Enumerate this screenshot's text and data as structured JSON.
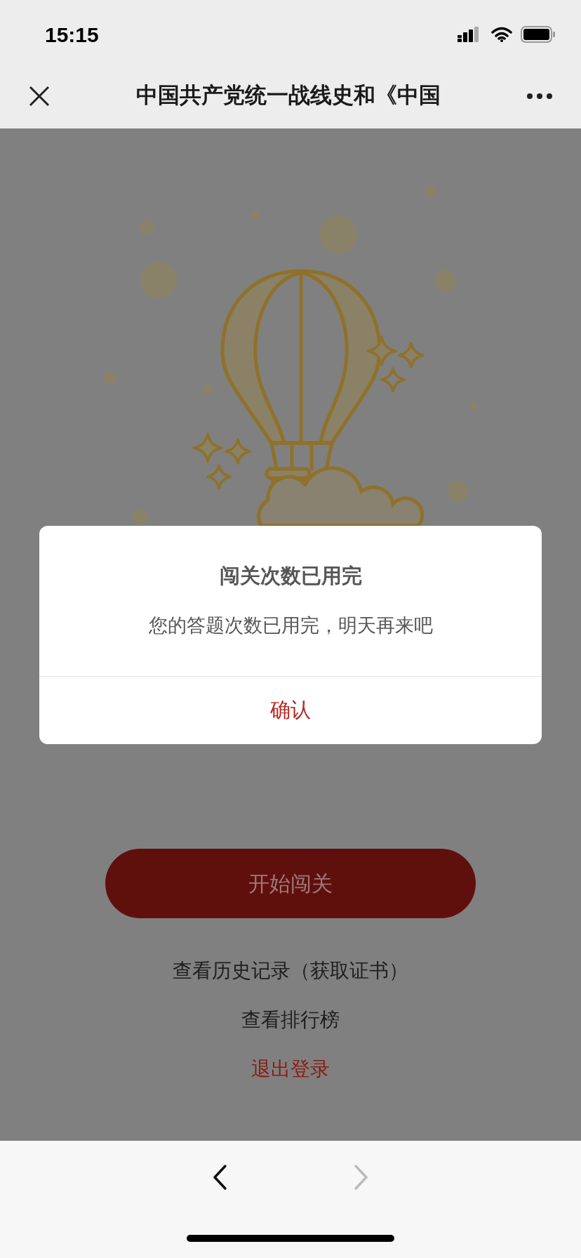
{
  "status_bar": {
    "time": "15:15"
  },
  "nav_bar": {
    "title": "中国共产党统一战线史和《中国"
  },
  "dialog": {
    "title": "闯关次数已用完",
    "message": "您的答题次数已用完，明天再来吧",
    "confirm": "确认"
  },
  "start_button": {
    "label": "开始闯关"
  },
  "links": [
    {
      "label": "查看历史记录（获取证书）",
      "kind": "default"
    },
    {
      "label": "查看排行榜",
      "kind": "default"
    },
    {
      "label": "退出登录",
      "kind": "danger"
    }
  ],
  "toolbar": {
    "back_disabled": false,
    "forward_disabled": true
  }
}
